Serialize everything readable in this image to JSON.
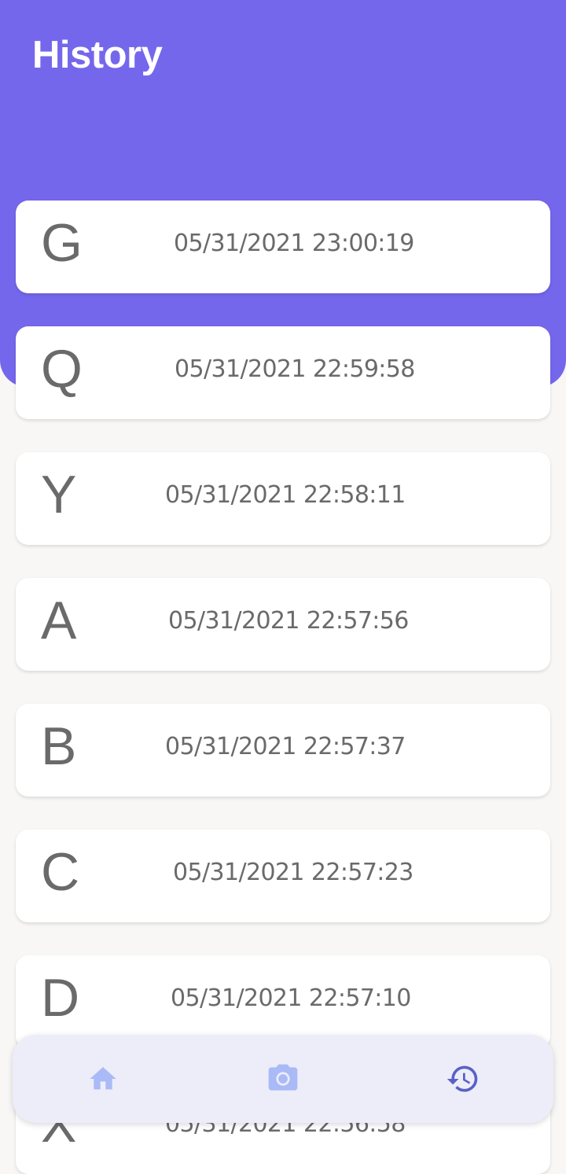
{
  "header": {
    "title": "History"
  },
  "history": {
    "items": [
      {
        "letter": "G",
        "timestamp": "05/31/2021 23:00:19"
      },
      {
        "letter": "Q",
        "timestamp": "05/31/2021 22:59:58"
      },
      {
        "letter": "Y",
        "timestamp": "05/31/2021 22:58:11"
      },
      {
        "letter": "A",
        "timestamp": "05/31/2021 22:57:56"
      },
      {
        "letter": "B",
        "timestamp": "05/31/2021 22:57:37"
      },
      {
        "letter": "C",
        "timestamp": "05/31/2021 22:57:23"
      },
      {
        "letter": "D",
        "timestamp": "05/31/2021 22:57:10"
      },
      {
        "letter": "X",
        "timestamp": "05/31/2021 22:56:58"
      }
    ]
  },
  "bottom_nav": {
    "items": [
      {
        "icon": "home-icon",
        "active": false
      },
      {
        "icon": "camera-icon",
        "active": false
      },
      {
        "icon": "history-icon",
        "active": true
      }
    ]
  },
  "colors": {
    "header": "#7567EC",
    "background": "#F8F7F6",
    "card": "#FFFFFF",
    "text": "#6A6A6A",
    "nav_background": "#ECEDF8",
    "nav_inactive": "#A9BAF6",
    "nav_active": "#5960C8"
  }
}
